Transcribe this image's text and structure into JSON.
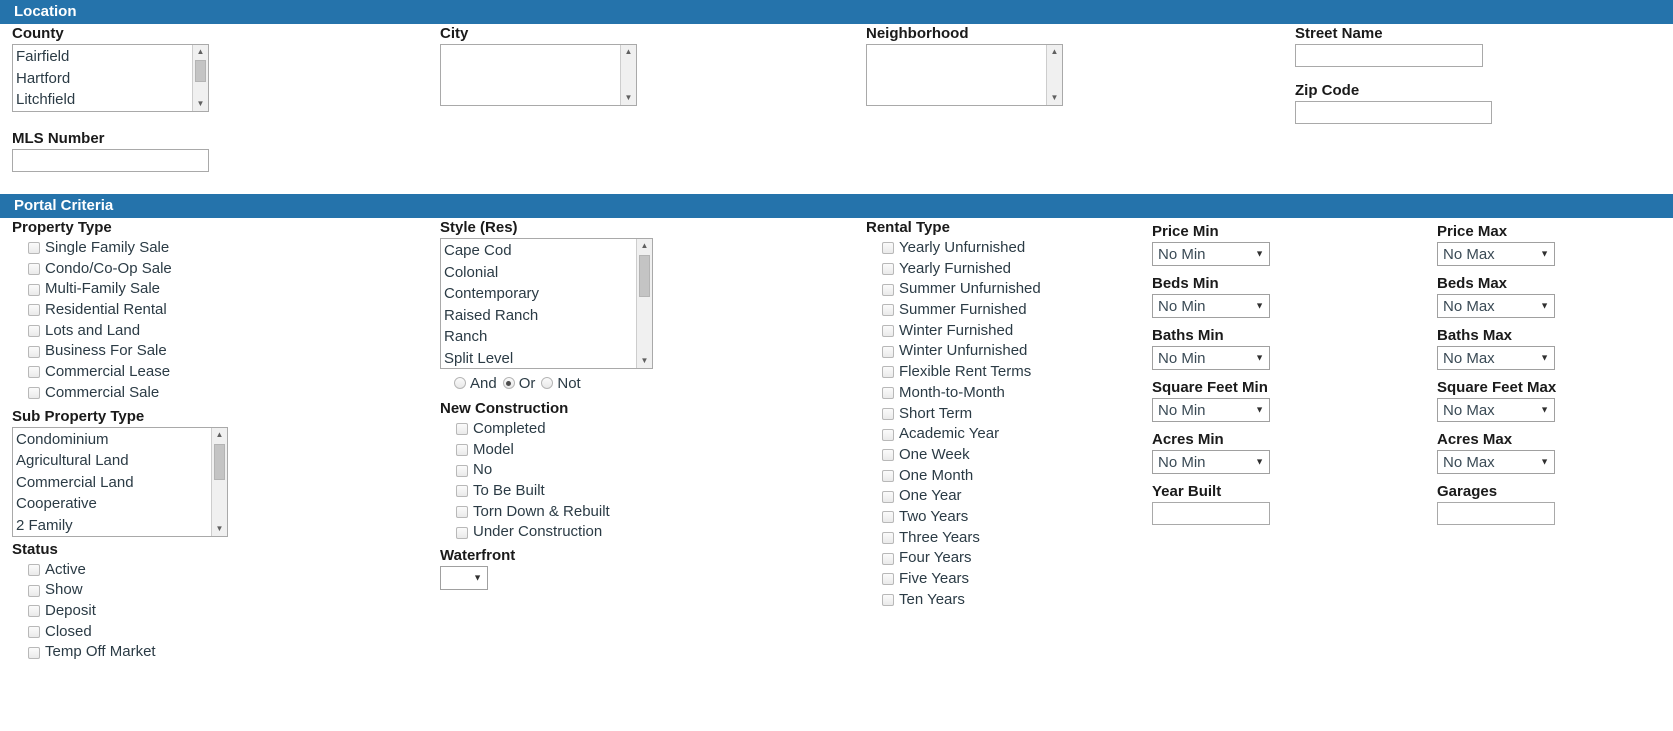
{
  "theme": {
    "header_bg": "#2573ab",
    "header_fg": "#ffffff",
    "field_border": "#a9a9a9"
  },
  "sections": {
    "location": {
      "title": "Location",
      "county": {
        "label": "County",
        "options": [
          "Fairfield",
          "Hartford",
          "Litchfield"
        ],
        "scroll_up_icon": "triangle-up-icon",
        "scroll_down_icon": "triangle-down-icon"
      },
      "city": {
        "label": "City",
        "options": [],
        "value": ""
      },
      "neighborhood": {
        "label": "Neighborhood",
        "options": [],
        "value": ""
      },
      "street_name": {
        "label": "Street Name",
        "value": "",
        "placeholder": ""
      },
      "zip_code": {
        "label": "Zip Code",
        "value": "",
        "placeholder": ""
      },
      "mls_number": {
        "label": "MLS Number",
        "value": "",
        "placeholder": ""
      }
    },
    "portal_criteria": {
      "title": "Portal Criteria",
      "property_type": {
        "label": "Property Type",
        "items": [
          {
            "label": "Single Family Sale",
            "checked": false
          },
          {
            "label": "Condo/Co-Op Sale",
            "checked": false
          },
          {
            "label": "Multi-Family Sale",
            "checked": false
          },
          {
            "label": "Residential Rental",
            "checked": false
          },
          {
            "label": "Lots and Land",
            "checked": false
          },
          {
            "label": "Business For Sale",
            "checked": false
          },
          {
            "label": "Commercial Lease",
            "checked": false
          },
          {
            "label": "Commercial Sale",
            "checked": false
          }
        ]
      },
      "sub_property_type": {
        "label": "Sub Property Type",
        "options": [
          "Condominium",
          "Agricultural Land",
          "Commercial Land",
          "Cooperative",
          "2 Family"
        ]
      },
      "status": {
        "label": "Status",
        "items": [
          {
            "label": "Active",
            "checked": false
          },
          {
            "label": "Show",
            "checked": false
          },
          {
            "label": "Deposit",
            "checked": false
          },
          {
            "label": "Closed",
            "checked": false
          },
          {
            "label": "Temp Off Market",
            "checked": false
          }
        ]
      },
      "style_res": {
        "label": "Style (Res)",
        "options": [
          "Cape Cod",
          "Colonial",
          "Contemporary",
          "Raised Ranch",
          "Ranch",
          "Split Level"
        ],
        "operators": [
          {
            "label": "And",
            "selected": false
          },
          {
            "label": "Or",
            "selected": true
          },
          {
            "label": "Not",
            "selected": false
          }
        ]
      },
      "new_construction": {
        "label": "New Construction",
        "items": [
          {
            "label": "Completed",
            "checked": false
          },
          {
            "label": "Model",
            "checked": false
          },
          {
            "label": "No",
            "checked": false
          },
          {
            "label": "To Be Built",
            "checked": false
          },
          {
            "label": "Torn Down & Rebuilt",
            "checked": false
          },
          {
            "label": "Under Construction",
            "checked": false
          }
        ]
      },
      "waterfront": {
        "label": "Waterfront",
        "value": "",
        "caret_icon": "chevron-down-icon"
      },
      "rental_type": {
        "label": "Rental Type",
        "items": [
          {
            "label": "Yearly Unfurnished",
            "checked": false
          },
          {
            "label": "Yearly Furnished",
            "checked": false
          },
          {
            "label": "Summer Unfurnished",
            "checked": false
          },
          {
            "label": "Summer Furnished",
            "checked": false
          },
          {
            "label": "Winter Furnished",
            "checked": false
          },
          {
            "label": "Winter Unfurnished",
            "checked": false
          },
          {
            "label": "Flexible Rent Terms",
            "checked": false
          },
          {
            "label": "Month-to-Month",
            "checked": false
          },
          {
            "label": "Short Term",
            "checked": false
          },
          {
            "label": "Academic Year",
            "checked": false
          },
          {
            "label": "One Week",
            "checked": false
          },
          {
            "label": "One Month",
            "checked": false
          },
          {
            "label": "One Year",
            "checked": false
          },
          {
            "label": "Two Years",
            "checked": false
          },
          {
            "label": "Three Years",
            "checked": false
          },
          {
            "label": "Four Years",
            "checked": false
          },
          {
            "label": "Five Years",
            "checked": false
          },
          {
            "label": "Ten Years",
            "checked": false
          }
        ]
      },
      "min_column": [
        {
          "label": "Price Min",
          "value": "No Min",
          "type": "select"
        },
        {
          "label": "Beds Min",
          "value": "No Min",
          "type": "select"
        },
        {
          "label": "Baths Min",
          "value": "No Min",
          "type": "select"
        },
        {
          "label": "Square Feet Min",
          "value": "No Min",
          "type": "select"
        },
        {
          "label": "Acres Min",
          "value": "No Min",
          "type": "select"
        },
        {
          "label": "Year Built",
          "value": "",
          "type": "text"
        }
      ],
      "max_column": [
        {
          "label": "Price Max",
          "value": "No Max",
          "type": "select"
        },
        {
          "label": "Beds Max",
          "value": "No Max",
          "type": "select"
        },
        {
          "label": "Baths Max",
          "value": "No Max",
          "type": "select"
        },
        {
          "label": "Square Feet Max",
          "value": "No Max",
          "type": "select"
        },
        {
          "label": "Acres Max",
          "value": "No Max",
          "type": "select"
        },
        {
          "label": "Garages",
          "value": "",
          "type": "text"
        }
      ]
    }
  }
}
